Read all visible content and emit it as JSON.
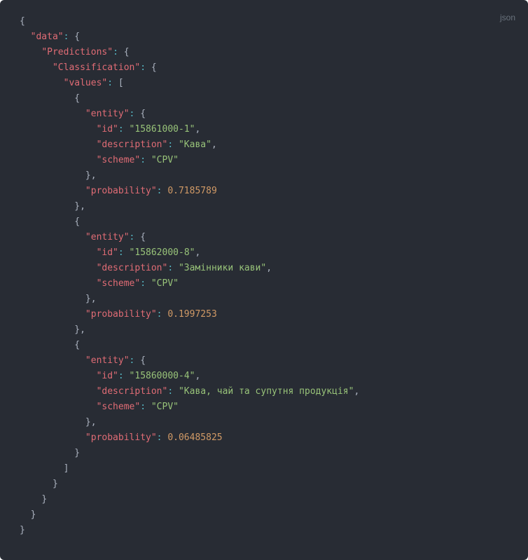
{
  "language_label": "json",
  "code": {
    "k_data": "\"data\"",
    "k_predictions": "\"Predictions\"",
    "k_classification": "\"Classification\"",
    "k_values": "\"values\"",
    "k_entity": "\"entity\"",
    "k_id": "\"id\"",
    "k_description": "\"description\"",
    "k_scheme": "\"scheme\"",
    "k_probability": "\"probability\"",
    "v_id1": "\"15861000-1\"",
    "v_desc1": "\"Кава\"",
    "v_scheme": "\"CPV\"",
    "v_prob1": "0.7185789",
    "v_id2": "\"15862000-8\"",
    "v_desc2": "\"Замінники кави\"",
    "v_prob2": "0.1997253",
    "v_id3": "\"15860000-4\"",
    "v_desc3": "\"Кава, чай та супутня продукція\"",
    "v_prob3": "0.06485825"
  },
  "chart_data": {
    "type": "table",
    "title": "JSON response: Predictions.Classification.values",
    "columns": [
      "id",
      "description",
      "scheme",
      "probability"
    ],
    "rows": [
      [
        "15861000-1",
        "Кава",
        "CPV",
        0.7185789
      ],
      [
        "15862000-8",
        "Замінники кави",
        "CPV",
        0.1997253
      ],
      [
        "15860000-4",
        "Кава, чай та супутня продукція",
        "CPV",
        0.06485825
      ]
    ]
  }
}
